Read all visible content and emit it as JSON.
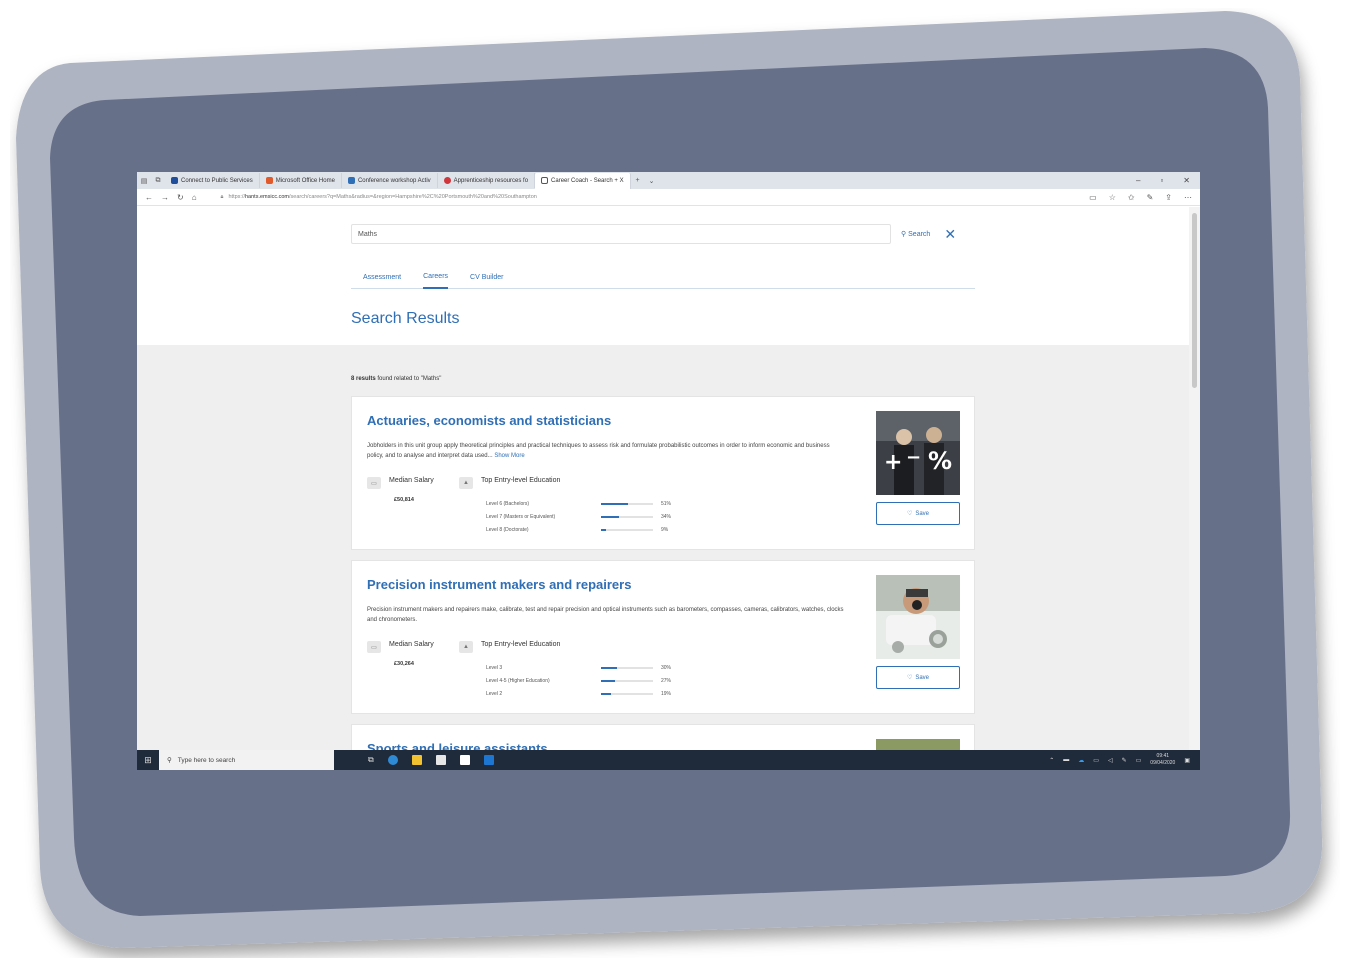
{
  "browser": {
    "tabs": [
      {
        "label": "Connect to Public Services",
        "color": "#1f4e9c"
      },
      {
        "label": "Microsoft Office Home",
        "color": "#e05a2b"
      },
      {
        "label": "Conference workshop Activ",
        "color": "#2f6fb5"
      },
      {
        "label": "Apprenticeship resources fo",
        "color": "#d0363b"
      },
      {
        "label": "Career Coach - Search + X",
        "color": "#555555"
      }
    ],
    "url_prefix": "https://",
    "url_host": "hants.emsicc.com",
    "url_path": "/search/careers?q=Maths&radius=&region=Hampshire%2C%20Portsmouth%20and%20Southampton"
  },
  "search": {
    "query": "Maths",
    "button_label": "Search"
  },
  "nav_tabs": [
    {
      "label": "Assessment"
    },
    {
      "label": "Careers"
    },
    {
      "label": "CV Builder"
    }
  ],
  "results_title": "Search Results",
  "results_count_bold": "8 results",
  "results_count_rest": " found related to \"Maths\"",
  "labels": {
    "median_salary": "Median Salary",
    "top_education": "Top Entry-level Education",
    "save": "Save",
    "show_more": "Show More"
  },
  "careers": [
    {
      "title": "Actuaries, economists and statisticians",
      "description": "Jobholders in this unit group apply theoretical principles and practical techniques to assess risk and formulate probabilistic outcomes in order to inform economic and business policy, and to analyse and interpret data used...",
      "salary": "£50,814",
      "education": [
        {
          "label": "Level 6 (Bachelors)",
          "value": "51%",
          "fraction": 0.51
        },
        {
          "label": "Level 7 (Masters or Equivalent)",
          "value": "34%",
          "fraction": 0.34
        },
        {
          "label": "Level 8 (Doctorate)",
          "value": "9%",
          "fraction": 0.09
        }
      ]
    },
    {
      "title": "Precision instrument makers and repairers",
      "description": "Precision instrument makers and repairers make, calibrate, test and repair precision and optical instruments such as barometers, compasses, cameras, calibrators, watches, clocks and chronometers.",
      "salary": "£30,264",
      "education": [
        {
          "label": "Level 3",
          "value": "30%",
          "fraction": 0.3
        },
        {
          "label": "Level 4-5 (Higher Education)",
          "value": "27%",
          "fraction": 0.27
        },
        {
          "label": "Level 2",
          "value": "19%",
          "fraction": 0.19
        }
      ]
    },
    {
      "title": "Sports and leisure assistants"
    }
  ],
  "taskbar": {
    "search_placeholder": "Type here to search",
    "time": "09:41",
    "date": "09/04/2020"
  },
  "colors": {
    "accent": "#2f6fb5",
    "frame": "#677089",
    "frame_border": "#aeb4c2"
  }
}
